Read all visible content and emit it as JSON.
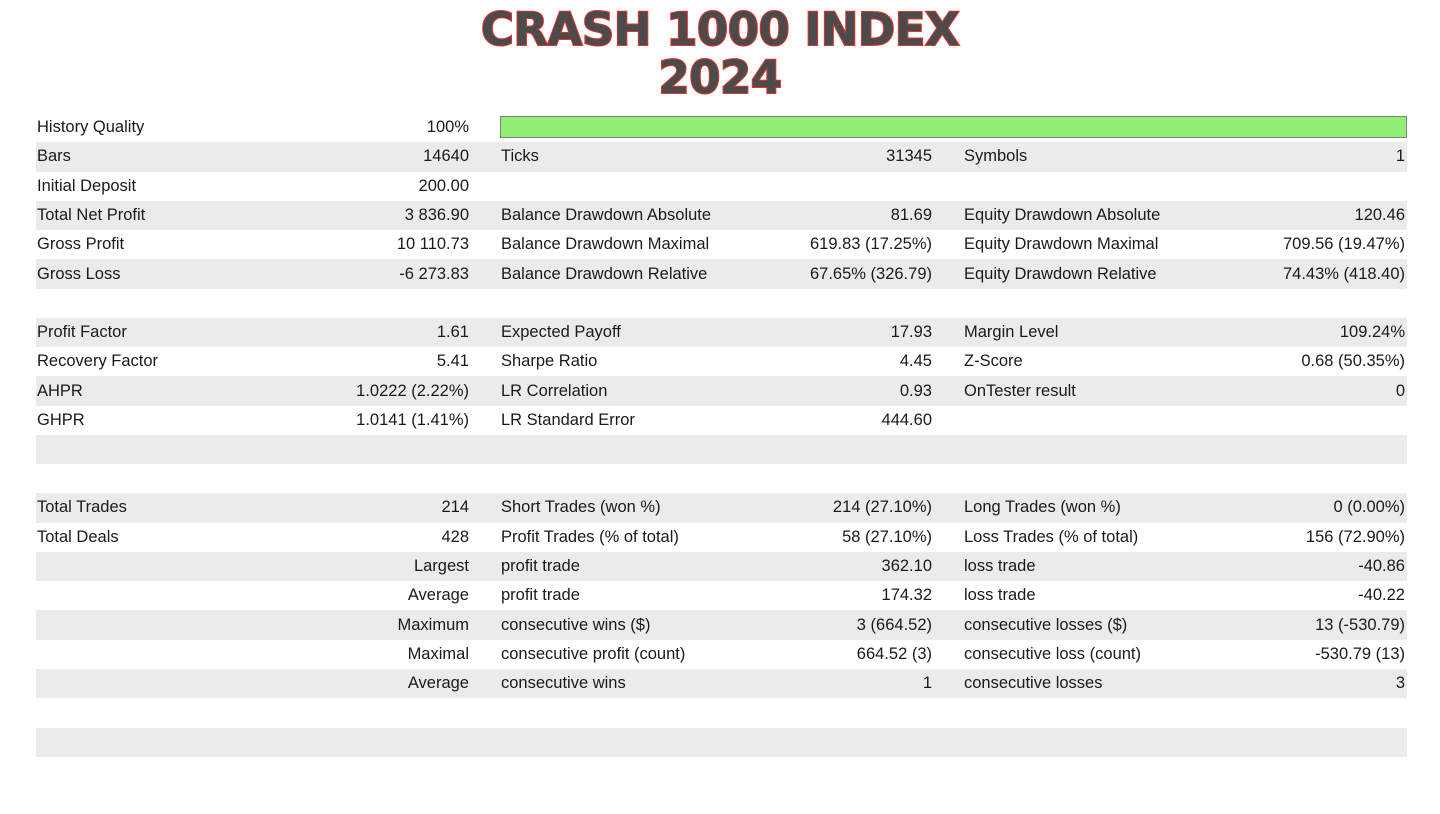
{
  "title": {
    "line1": "CRASH 1000 INDEX",
    "line2": "2024",
    "text_color": "#4b4b4b",
    "outline_color": "#e63329"
  },
  "quality_bar": {
    "name": "history-quality-bar",
    "fill_percent": 100,
    "fill_color": "#90ee72",
    "border_color": "#808080"
  },
  "rows": [
    {
      "c1_label": "History Quality",
      "c1_value": "100%",
      "c2_label": "",
      "c2_value": "",
      "c3_label": "",
      "c3_value": ""
    },
    {
      "c1_label": "Bars",
      "c1_value": "14640",
      "c2_label": "Ticks",
      "c2_value": "31345",
      "c3_label": "Symbols",
      "c3_value": "1"
    },
    {
      "c1_label": "Initial Deposit",
      "c1_value": "200.00",
      "c2_label": "",
      "c2_value": "",
      "c3_label": "",
      "c3_value": ""
    },
    {
      "c1_label": "Total Net Profit",
      "c1_value": "3 836.90",
      "c2_label": "Balance Drawdown Absolute",
      "c2_value": "81.69",
      "c3_label": "Equity Drawdown Absolute",
      "c3_value": "120.46"
    },
    {
      "c1_label": "Gross Profit",
      "c1_value": "10 110.73",
      "c2_label": "Balance Drawdown Maximal",
      "c2_value": "619.83 (17.25%)",
      "c3_label": "Equity Drawdown Maximal",
      "c3_value": "709.56 (19.47%)"
    },
    {
      "c1_label": "Gross Loss",
      "c1_value": "-6 273.83",
      "c2_label": "Balance Drawdown Relative",
      "c2_value": "67.65% (326.79)",
      "c3_label": "Equity Drawdown Relative",
      "c3_value": "74.43% (418.40)"
    },
    {
      "c1_label": "Profit Factor",
      "c1_value": "1.61",
      "c2_label": "Expected Payoff",
      "c2_value": "17.93",
      "c3_label": "Margin Level",
      "c3_value": "109.24%"
    },
    {
      "c1_label": "Recovery Factor",
      "c1_value": "5.41",
      "c2_label": "Sharpe Ratio",
      "c2_value": "4.45",
      "c3_label": "Z-Score",
      "c3_value": "0.68 (50.35%)"
    },
    {
      "c1_label": "AHPR",
      "c1_value": "1.0222 (2.22%)",
      "c2_label": "LR Correlation",
      "c2_value": "0.93",
      "c3_label": "OnTester result",
      "c3_value": "0"
    },
    {
      "c1_label": "GHPR",
      "c1_value": "1.0141 (1.41%)",
      "c2_label": "LR Standard Error",
      "c2_value": "444.60",
      "c3_label": "",
      "c3_value": ""
    },
    {
      "c1_label": "Total Trades",
      "c1_value": "214",
      "c2_label": "Short Trades (won %)",
      "c2_value": "214 (27.10%)",
      "c3_label": "Long Trades (won %)",
      "c3_value": "0 (0.00%)"
    },
    {
      "c1_label": "Total Deals",
      "c1_value": "428",
      "c2_label": "Profit Trades (% of total)",
      "c2_value": "58 (27.10%)",
      "c3_label": "Loss Trades (% of total)",
      "c3_value": "156 (72.90%)"
    },
    {
      "c1_label": "",
      "c1_value": "Largest",
      "c2_label": "profit trade",
      "c2_value": "362.10",
      "c3_label": "loss trade",
      "c3_value": "-40.86"
    },
    {
      "c1_label": "",
      "c1_value": "Average",
      "c2_label": "profit trade",
      "c2_value": "174.32",
      "c3_label": "loss trade",
      "c3_value": "-40.22"
    },
    {
      "c1_label": "",
      "c1_value": "Maximum",
      "c2_label": "consecutive wins ($)",
      "c2_value": "3 (664.52)",
      "c3_label": "consecutive losses ($)",
      "c3_value": "13 (-530.79)"
    },
    {
      "c1_label": "",
      "c1_value": "Maximal",
      "c2_label": "consecutive profit (count)",
      "c2_value": "664.52 (3)",
      "c3_label": "consecutive loss (count)",
      "c3_value": "-530.79 (13)"
    },
    {
      "c1_label": "",
      "c1_value": "Average",
      "c2_label": "consecutive wins",
      "c2_value": "1",
      "c3_label": "consecutive losses",
      "c3_value": "3"
    }
  ]
}
